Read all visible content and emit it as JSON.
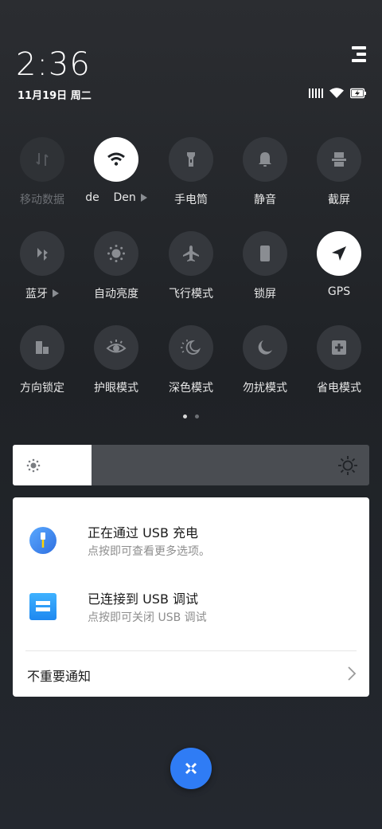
{
  "status": {
    "time": "2:36",
    "date": "11月19日 周二"
  },
  "toggles": [
    {
      "label": "移动数据",
      "icon": "mobile-data-icon",
      "state": "disabled"
    },
    {
      "label": "de    Den",
      "icon": "wifi-icon",
      "state": "on",
      "has_more": true
    },
    {
      "label": "手电筒",
      "icon": "flashlight-icon",
      "state": "off"
    },
    {
      "label": "静音",
      "icon": "bell-icon",
      "state": "off"
    },
    {
      "label": "截屏",
      "icon": "screenshot-icon",
      "state": "off"
    },
    {
      "label": "蓝牙",
      "icon": "bluetooth-icon",
      "state": "off",
      "has_more": true
    },
    {
      "label": "自动亮度",
      "icon": "auto-brightness-icon",
      "state": "off"
    },
    {
      "label": "飞行模式",
      "icon": "airplane-icon",
      "state": "off"
    },
    {
      "label": "锁屏",
      "icon": "lock-screen-icon",
      "state": "off"
    },
    {
      "label": "GPS",
      "icon": "gps-icon",
      "state": "on"
    },
    {
      "label": "方向锁定",
      "icon": "rotation-lock-icon",
      "state": "off"
    },
    {
      "label": "护眼模式",
      "icon": "eye-icon",
      "state": "off"
    },
    {
      "label": "深色模式",
      "icon": "dark-mode-icon",
      "state": "off"
    },
    {
      "label": "勿扰模式",
      "icon": "moon-icon",
      "state": "off"
    },
    {
      "label": "省电模式",
      "icon": "battery-saver-icon",
      "state": "off"
    }
  ],
  "brightness": {
    "level": 0.22
  },
  "notifications": [
    {
      "title": "正在通过 USB 充电",
      "subtitle": "点按即可查看更多选项。",
      "icon": "usb-charging-icon"
    },
    {
      "title": "已连接到 USB 调试",
      "subtitle": "点按即可关闭 USB 调试",
      "icon": "usb-debug-icon"
    }
  ],
  "minor_notifications_label": "不重要通知",
  "colors": {
    "accent": "#2f7cf5",
    "background": "#222529",
    "card": "#ffffff"
  }
}
